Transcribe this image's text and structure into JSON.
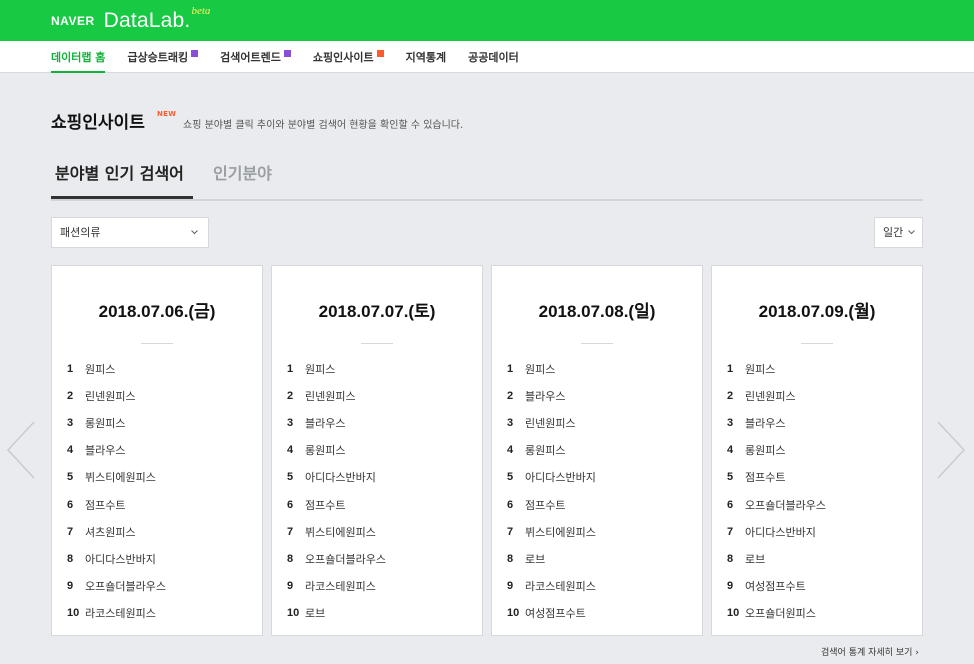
{
  "brand": {
    "naver": "NAVER",
    "datalab": "DataLab.",
    "beta": "beta"
  },
  "nav": [
    {
      "label": "데이터랩 홈",
      "active": true,
      "badge": ""
    },
    {
      "label": "급상승트래킹",
      "active": false,
      "badge": "b"
    },
    {
      "label": "검색어트렌드",
      "active": false,
      "badge": "b"
    },
    {
      "label": "쇼핑인사이트",
      "active": false,
      "badge": "n"
    },
    {
      "label": "지역통계",
      "active": false,
      "badge": ""
    },
    {
      "label": "공공데이터",
      "active": false,
      "badge": ""
    }
  ],
  "page": {
    "title": "쇼핑인사이트",
    "new_tag": "NEW",
    "description": "쇼핑 분야별 클릭 추이와 분야별 검색어 현황을 확인할 수 있습니다."
  },
  "tabs": {
    "active": "분야별 인기 검색어",
    "inactive": "인기분야"
  },
  "filters": {
    "category": "패션의류",
    "period": "일간"
  },
  "days": [
    {
      "date": "2018.07.06.(금)",
      "ranks": [
        "원피스",
        "린넨원피스",
        "롱원피스",
        "블라우스",
        "뷔스티에원피스",
        "점프수트",
        "셔츠원피스",
        "아디다스반바지",
        "오프숄더블라우스",
        "라코스테원피스"
      ]
    },
    {
      "date": "2018.07.07.(토)",
      "ranks": [
        "원피스",
        "린넨원피스",
        "블라우스",
        "롱원피스",
        "아디다스반바지",
        "점프수트",
        "뷔스티에원피스",
        "오프숄더블라우스",
        "라코스테원피스",
        "로브"
      ]
    },
    {
      "date": "2018.07.08.(일)",
      "ranks": [
        "원피스",
        "블라우스",
        "린넨원피스",
        "롱원피스",
        "아디다스반바지",
        "점프수트",
        "뷔스티에원피스",
        "로브",
        "라코스테원피스",
        "여성점프수트"
      ]
    },
    {
      "date": "2018.07.09.(월)",
      "ranks": [
        "원피스",
        "린넨원피스",
        "블라우스",
        "롱원피스",
        "점프수트",
        "오프숄더블라우스",
        "아디다스반바지",
        "로브",
        "여성점프수트",
        "오프숄더원피스"
      ]
    }
  ],
  "icons": {
    "prev": "chevron-left-icon",
    "next": "chevron-right-icon",
    "dropdown": "chevron-down-icon",
    "more": "chevron-right-icon"
  },
  "footer": {
    "more_link": "검색어 통계 자세히 보기 ›"
  },
  "colors": {
    "brand_green": "#17c943",
    "active_nav": "#13b13b",
    "new_tag": "#ff5a2c"
  }
}
